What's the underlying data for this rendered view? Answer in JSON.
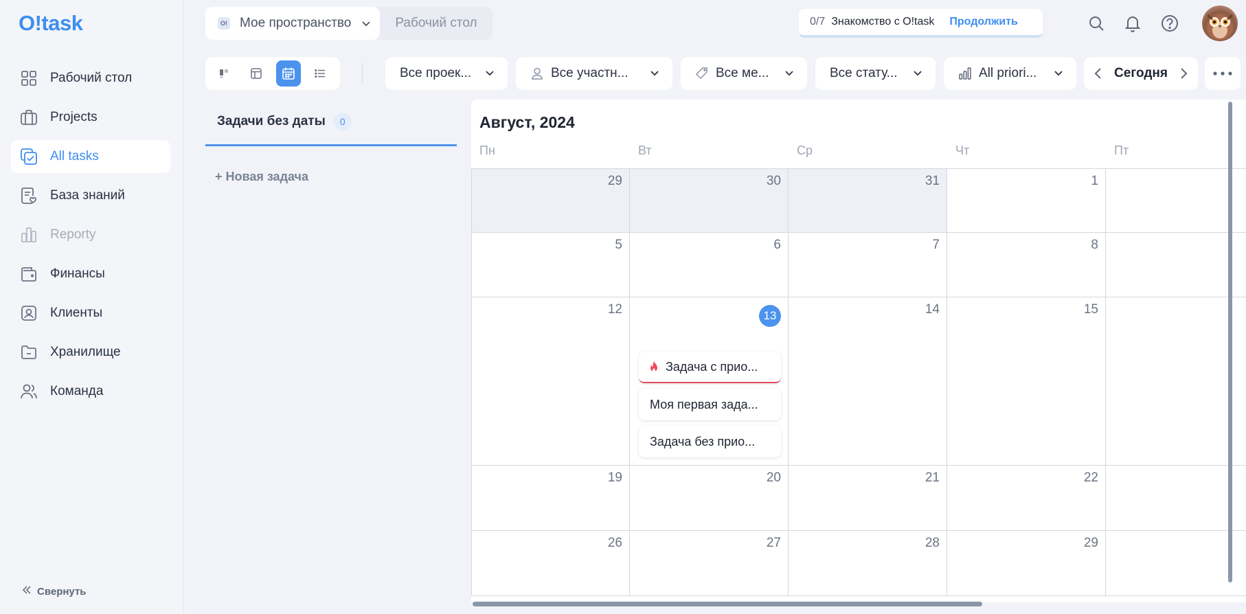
{
  "app": {
    "logo": "O!task"
  },
  "sidebar": {
    "items": [
      {
        "label": "Рабочий стол",
        "icon": "grid-icon",
        "state": "normal"
      },
      {
        "label": "Projects",
        "icon": "briefcase-icon",
        "state": "normal"
      },
      {
        "label": "All tasks",
        "icon": "tasks-check-icon",
        "state": "active"
      },
      {
        "label": "База знаний",
        "icon": "knowledge-base-icon",
        "state": "normal"
      },
      {
        "label": "Reporty",
        "icon": "reports-icon",
        "state": "disabled"
      },
      {
        "label": "Финансы",
        "icon": "wallet-icon",
        "state": "normal"
      },
      {
        "label": "Клиенты",
        "icon": "client-card-icon",
        "state": "normal"
      },
      {
        "label": "Хранилище",
        "icon": "folder-icon",
        "state": "normal"
      },
      {
        "label": "Команда",
        "icon": "team-icon",
        "state": "normal"
      }
    ],
    "collapse_label": "Свернуть"
  },
  "header": {
    "workspace_badge": "O!",
    "workspace": "Мое пространство",
    "desk_tab": "Рабочий стол",
    "onboarding": {
      "count": "0/7",
      "title": "Знакомство с O!task",
      "action": "Продолжить",
      "progress": 0
    },
    "icons": [
      "search-icon",
      "bell-icon",
      "help-icon"
    ]
  },
  "toolbar": {
    "views": [
      "kanban-view-icon",
      "table-view-icon",
      "calendar-view-icon",
      "list-view-icon"
    ],
    "active_view": "calendar-view-icon",
    "filters": {
      "projects": "Все проек...",
      "members": "Все участн...",
      "labels": "Все ме...",
      "statuses": "Все стату...",
      "priorities": "All priori..."
    },
    "today_label": "Сегодня"
  },
  "undated": {
    "tab_label": "Задачи без даты",
    "count": "0",
    "new_task": "+ Новая задача"
  },
  "calendar": {
    "month_title": "Август, 2024",
    "weekdays": [
      "Пн",
      "Вт",
      "Ср",
      "Чт",
      "Пт"
    ],
    "weeks": [
      [
        "29",
        "30",
        "31",
        "1",
        ""
      ],
      [
        "5",
        "6",
        "7",
        "8",
        ""
      ],
      [
        "12",
        "13",
        "14",
        "15",
        ""
      ],
      [
        "19",
        "20",
        "21",
        "22",
        ""
      ],
      [
        "26",
        "27",
        "28",
        "29",
        ""
      ]
    ],
    "today": "13",
    "tasks": [
      {
        "title": "Задача с прио...",
        "priority": "high"
      },
      {
        "title": "Моя первая зада..."
      },
      {
        "title": "Задача без прио..."
      }
    ],
    "colors": {
      "accent": "#4b93ec",
      "high_priority": "#e24b5a"
    }
  }
}
